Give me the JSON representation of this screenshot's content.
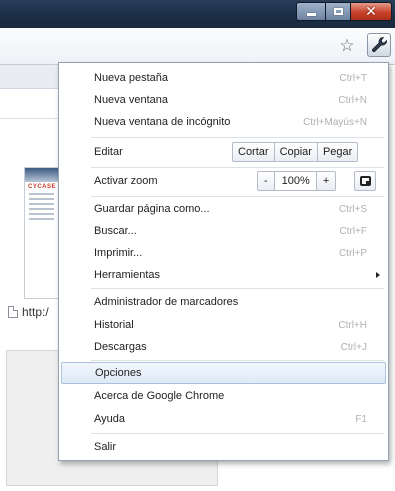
{
  "window": {
    "minimize_glyph": "",
    "close_glyph": "✕"
  },
  "toolbar": {
    "bookmark_icon": "star-icon",
    "star_glyph": "☆",
    "menu_icon": "wrench-icon"
  },
  "page": {
    "link_text": "http:/",
    "thumbnail_logo_text": "CYCASE"
  },
  "menu": {
    "new_tab": {
      "label": "Nueva pestaña",
      "shortcut": "Ctrl+T"
    },
    "new_window": {
      "label": "Nueva ventana",
      "shortcut": "Ctrl+N"
    },
    "incognito": {
      "label": "Nueva ventana de incógnito",
      "shortcut": "Ctrl+Mayús+N"
    },
    "edit": {
      "label": "Editar",
      "cut": "Cortar",
      "copy": "Copiar",
      "paste": "Pegar"
    },
    "zoom": {
      "label": "Activar zoom",
      "minus": "-",
      "value": "100%",
      "plus": "+"
    },
    "save_page": {
      "label": "Guardar página como...",
      "shortcut": "Ctrl+S"
    },
    "find": {
      "label": "Buscar...",
      "shortcut": "Ctrl+F"
    },
    "print": {
      "label": "Imprimir...",
      "shortcut": "Ctrl+P"
    },
    "tools": {
      "label": "Herramientas"
    },
    "bookmark_manager": {
      "label": "Administrador de marcadores"
    },
    "history": {
      "label": "Historial",
      "shortcut": "Ctrl+H"
    },
    "downloads": {
      "label": "Descargas",
      "shortcut": "Ctrl+J"
    },
    "options": {
      "label": "Opciones",
      "highlighted": true
    },
    "about": {
      "label": "Acerca de Google Chrome"
    },
    "help": {
      "label": "Ayuda",
      "shortcut": "F1"
    },
    "exit": {
      "label": "Salir"
    }
  },
  "colors": {
    "titlebar": "#1b2e45",
    "highlight": "#dde9f7",
    "highlight_border": "#a8c2e0",
    "shortcut_text": "#b0b0b0"
  }
}
